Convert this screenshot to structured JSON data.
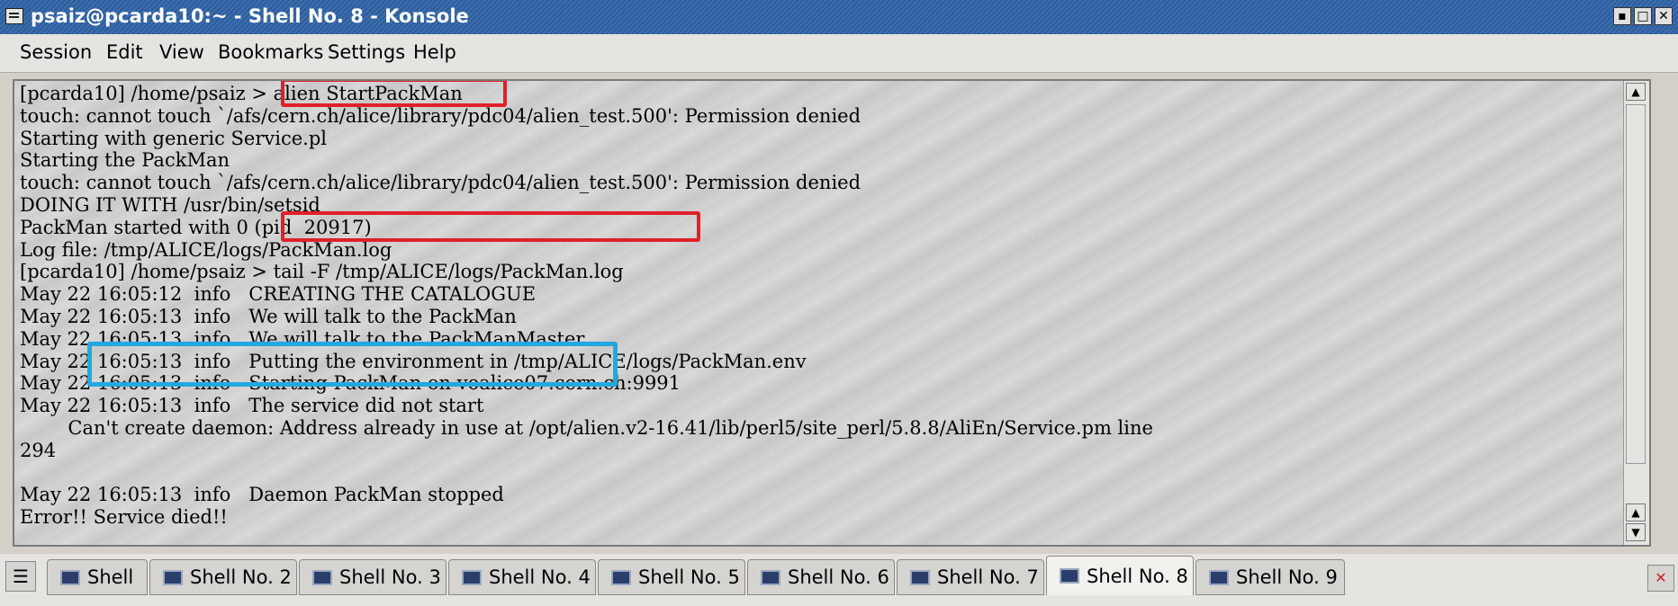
{
  "window": {
    "title": "psaiz@pcarda10:~ - Shell No. 8 - Konsole",
    "buttons": [
      "▪",
      "□",
      "✕"
    ]
  },
  "menubar": [
    "Session",
    "Edit",
    "View",
    "Bookmarks",
    "Settings",
    "Help"
  ],
  "terminal": {
    "lines": [
      "[pcarda10] /home/psaiz > alien StartPackMan",
      "touch: cannot touch `/afs/cern.ch/alice/library/pdc04/alien_test.500': Permission denied",
      "Starting with generic Service.pl",
      "Starting the PackMan",
      "touch: cannot touch `/afs/cern.ch/alice/library/pdc04/alien_test.500': Permission denied",
      "DOING IT WITH /usr/bin/setsid",
      "PackMan started with 0 (pid  20917)",
      "Log file: /tmp/ALICE/logs/PackMan.log",
      "[pcarda10] /home/psaiz > tail -F /tmp/ALICE/logs/PackMan.log",
      "May 22 16:05:12  info   CREATING THE CATALOGUE",
      "May 22 16:05:13  info   We will talk to the PackMan",
      "May 22 16:05:13  info   We will talk to the PackManMaster",
      "May 22 16:05:13  info   Putting the environment in /tmp/ALICE/logs/PackMan.env",
      "May 22 16:05:13  info   Starting PackMan on voalice07.cern.ch:9991",
      "May 22 16:05:13  info   The service did not start",
      "        Can't create daemon: Address already in use at /opt/alien.v2-16.41/lib/perl5/site_perl/5.8.8/AliEn/Service.pm line",
      "294",
      "",
      "May 22 16:05:13  info   Daemon PackMan stopped",
      "Error!! Service died!!"
    ]
  },
  "tabs": [
    "Shell",
    "Shell No. 2",
    "Shell No. 3",
    "Shell No. 4",
    "Shell No. 5",
    "Shell No. 6",
    "Shell No. 7",
    "Shell No. 8",
    "Shell No. 9"
  ],
  "active_tab": "Shell No. 8",
  "colors": {
    "highlight_red": "#e0202a",
    "highlight_blue": "#22a8e0",
    "titlebar": "#3c6fb0"
  }
}
